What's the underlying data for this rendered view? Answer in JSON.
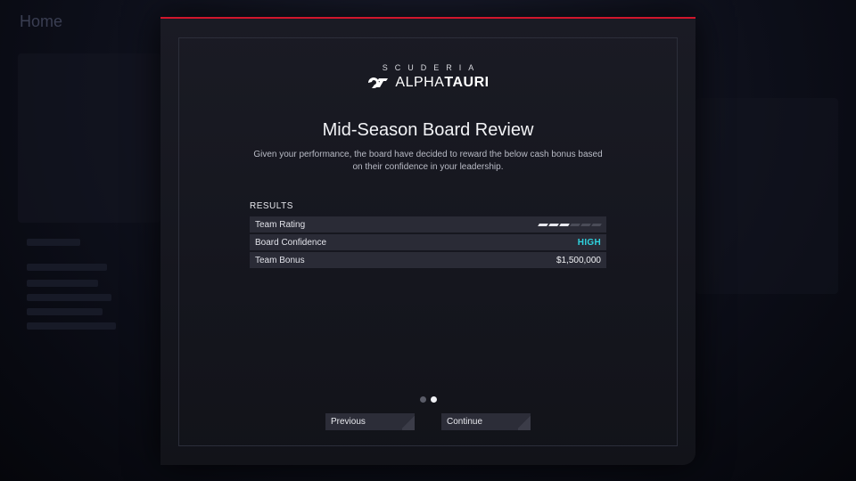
{
  "background": {
    "screen_title": "Home"
  },
  "modal": {
    "brand": {
      "top": "SCUDERIA",
      "name_light": "ALPHA",
      "name_bold": "TAURI"
    },
    "title": "Mid-Season Board Review",
    "subtitle": "Given your performance, the board have decided to reward the below cash bonus based on their confidence in your leadership.",
    "results_label": "RESULTS",
    "results": {
      "team_rating": {
        "label": "Team Rating",
        "value": 3,
        "max": 6
      },
      "board_confidence": {
        "label": "Board Confidence",
        "value": "HIGH"
      },
      "team_bonus": {
        "label": "Team Bonus",
        "value": "$1,500,000"
      }
    },
    "pagination": {
      "current": 2,
      "total": 2
    },
    "buttons": {
      "previous": "Previous",
      "continue": "Continue"
    }
  },
  "colors": {
    "accent_red": "#d0162c",
    "confidence_high": "#2fd3df"
  }
}
